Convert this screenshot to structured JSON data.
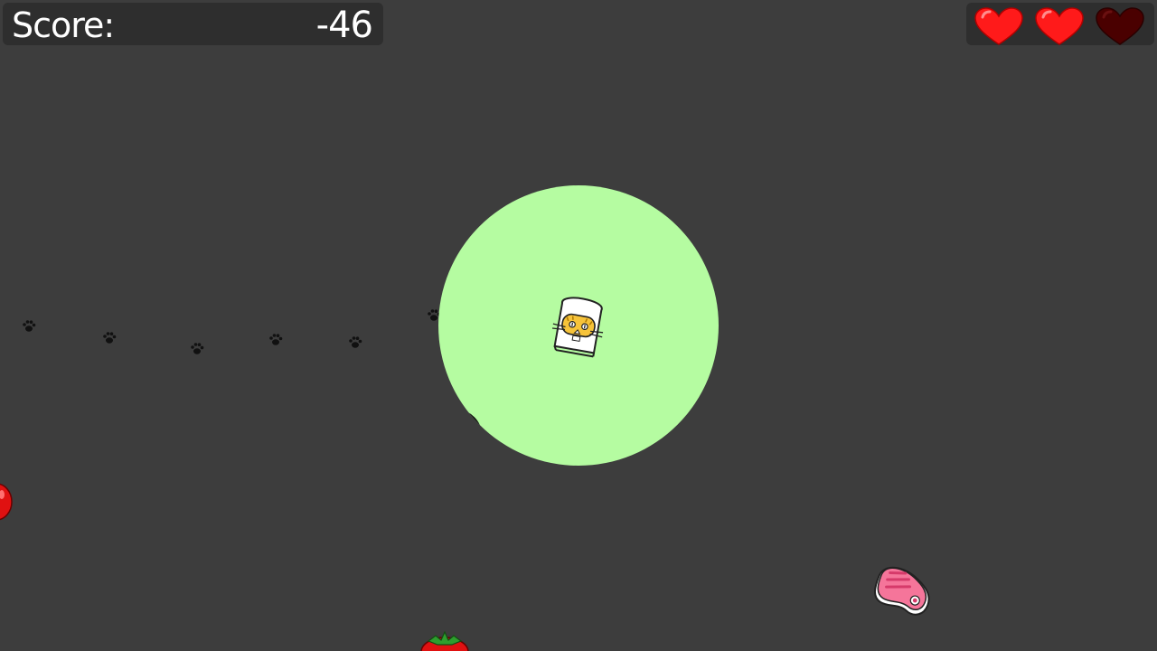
{
  "hud": {
    "score_label": "Score:",
    "score_value": "-46",
    "lives_total": 3,
    "lives_remaining": 2
  },
  "colors": {
    "background": "#3d3d3d",
    "hud_panel": "#2e2e2e",
    "range_circle": "#b5fca1",
    "heart_full": "#ff1a1a",
    "heart_empty": "#4a0000"
  },
  "sprites": {
    "player": "cat-face-toast",
    "pickups": [
      "tomato",
      "strawberry",
      "steak"
    ],
    "trail": "paw-print",
    "hazard": "dark-ring"
  }
}
